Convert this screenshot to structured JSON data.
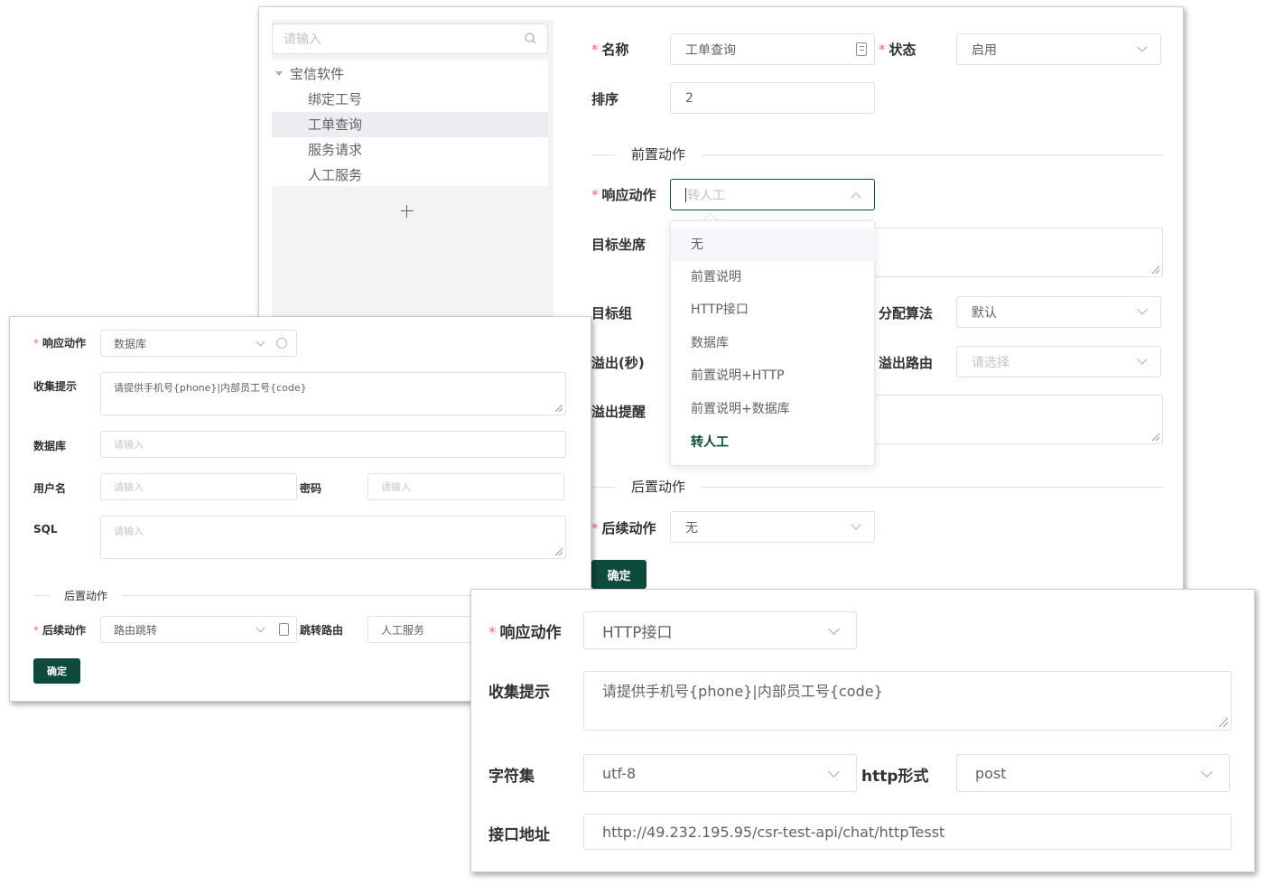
{
  "main": {
    "tree": {
      "search_placeholder": "请输入",
      "root": "宝信软件",
      "items": [
        "绑定工号",
        "工单查询",
        "服务请求",
        "人工服务"
      ],
      "selected_index": 1,
      "add_icon": "plus-icon"
    },
    "form": {
      "name_label": "名称",
      "name_value": "工单查询",
      "status_label": "状态",
      "status_value": "启用",
      "order_label": "排序",
      "order_value": "2",
      "pre_action_divider": "前置动作",
      "response_label": "响应动作",
      "response_placeholder": "转人工",
      "target_seat_label": "目标坐席",
      "target_group_label": "目标组",
      "algo_label": "分配算法",
      "algo_value": "默认",
      "overflow_sec_label": "溢出(秒)",
      "overflow_route_label": "溢出路由",
      "overflow_route_placeholder": "请选择",
      "overflow_remind_label": "溢出提醒",
      "post_action_divider": "后置动作",
      "follow_label": "后续动作",
      "follow_value": "无",
      "confirm_label": "确定"
    },
    "dropdown": {
      "options": [
        "无",
        "前置说明",
        "HTTP接口",
        "数据库",
        "前置说明+HTTP",
        "前置说明+数据库",
        "转人工"
      ],
      "hover_index": 0,
      "selected_index": 6
    }
  },
  "db_panel": {
    "response_label": "响应动作",
    "response_value": "数据库",
    "collect_label": "收集提示",
    "collect_value": "请提供手机号{phone}|内部员工号{code}",
    "db_label": "数据库",
    "db_placeholder": "请输入",
    "user_label": "用户名",
    "user_placeholder": "请输入",
    "pwd_label": "密码",
    "pwd_placeholder": "请输入",
    "sql_label": "SQL",
    "sql_placeholder": "请输入",
    "post_action_divider": "后置动作",
    "follow_label": "后续动作",
    "follow_value": "路由跳转",
    "jump_label": "跳转路由",
    "jump_value": "人工服务",
    "confirm_label": "确定"
  },
  "http_panel": {
    "response_label": "响应动作",
    "response_value": "HTTP接口",
    "collect_label": "收集提示",
    "collect_value": "请提供手机号{phone}|内部员工号{code}",
    "charset_label": "字符集",
    "charset_value": "utf-8",
    "http_label": "http形式",
    "http_value": "post",
    "url_label": "接口地址",
    "url_value": "http://49.232.195.95/csr-test-api/chat/httpTesst"
  }
}
